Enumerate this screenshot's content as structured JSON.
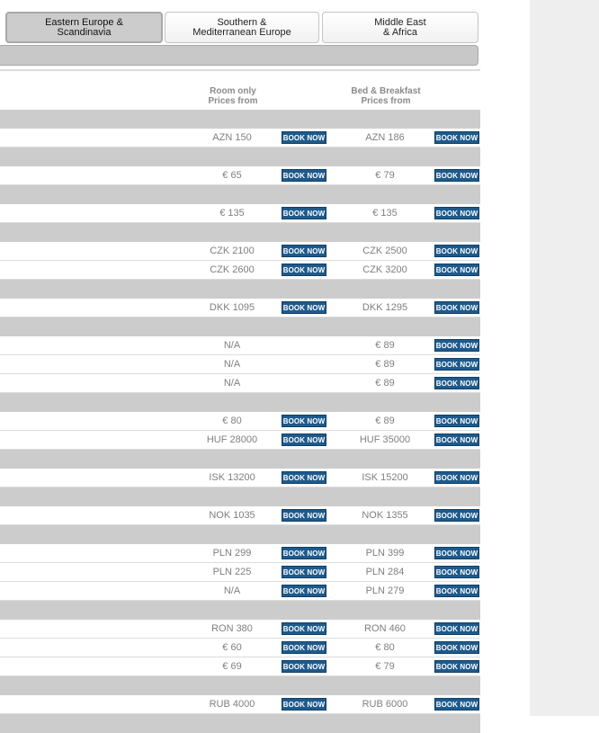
{
  "tabs": [
    {
      "label": "Eastern Europe &\nScandinavia",
      "active": true
    },
    {
      "label": "Southern &\nMediterranean Europe",
      "active": false
    },
    {
      "label": "Middle East\n& Africa",
      "active": false
    }
  ],
  "columns": {
    "room_only": "Room only\nPrices from",
    "bed_breakfast": "Bed & Breakfast\nPrices from"
  },
  "book_label": "BOOK NOW",
  "sections": [
    {
      "rows": [
        {
          "room": "AZN 150",
          "room_book": true,
          "bb": "AZN 186",
          "bb_book": true
        }
      ]
    },
    {
      "rows": [
        {
          "room": "€ 65",
          "room_book": true,
          "bb": "€ 79",
          "bb_book": true
        }
      ]
    },
    {
      "rows": [
        {
          "room": "€ 135",
          "room_book": true,
          "bb": "€ 135",
          "bb_book": true
        }
      ]
    },
    {
      "rows": [
        {
          "room": "CZK 2100",
          "room_book": true,
          "bb": "CZK 2500",
          "bb_book": true
        },
        {
          "room": "CZK 2600",
          "room_book": true,
          "bb": "CZK 3200",
          "bb_book": true
        }
      ]
    },
    {
      "rows": [
        {
          "room": "DKK 1095",
          "room_book": true,
          "bb": "DKK 1295",
          "bb_book": true
        }
      ]
    },
    {
      "rows": [
        {
          "room": "N/A",
          "room_book": false,
          "bb": "€ 89",
          "bb_book": true
        },
        {
          "room": "N/A",
          "room_book": false,
          "bb": "€ 89",
          "bb_book": true
        },
        {
          "room": "N/A",
          "room_book": false,
          "bb": "€ 89",
          "bb_book": true
        }
      ]
    },
    {
      "rows": [
        {
          "room": "€ 80",
          "room_book": true,
          "bb": "€ 89",
          "bb_book": true
        },
        {
          "room": "HUF 28000",
          "room_book": true,
          "bb": "HUF 35000",
          "bb_book": true
        }
      ]
    },
    {
      "rows": [
        {
          "room": "ISK 13200",
          "room_book": true,
          "bb": "ISK 15200",
          "bb_book": true
        }
      ]
    },
    {
      "rows": [
        {
          "room": "NOK 1035",
          "room_book": true,
          "bb": "NOK 1355",
          "bb_book": true
        }
      ]
    },
    {
      "rows": [
        {
          "room": "PLN 299",
          "room_book": true,
          "bb": "PLN 399",
          "bb_book": true
        },
        {
          "room": "PLN 225",
          "room_book": true,
          "bb": "PLN 284",
          "bb_book": true
        },
        {
          "room": "N/A",
          "room_book": true,
          "bb": "PLN 279",
          "bb_book": true
        }
      ]
    },
    {
      "rows": [
        {
          "room": "RON 380",
          "room_book": true,
          "bb": "RON 460",
          "bb_book": true
        },
        {
          "room": "€ 60",
          "room_book": true,
          "bb": "€ 80",
          "bb_book": true
        },
        {
          "room": "€ 69",
          "room_book": true,
          "bb": "€ 79",
          "bb_book": true
        }
      ]
    },
    {
      "rows": [
        {
          "room": "RUB 4000",
          "room_book": true,
          "bb": "RUB 6000",
          "bb_book": true
        }
      ]
    },
    {
      "rows": []
    }
  ]
}
